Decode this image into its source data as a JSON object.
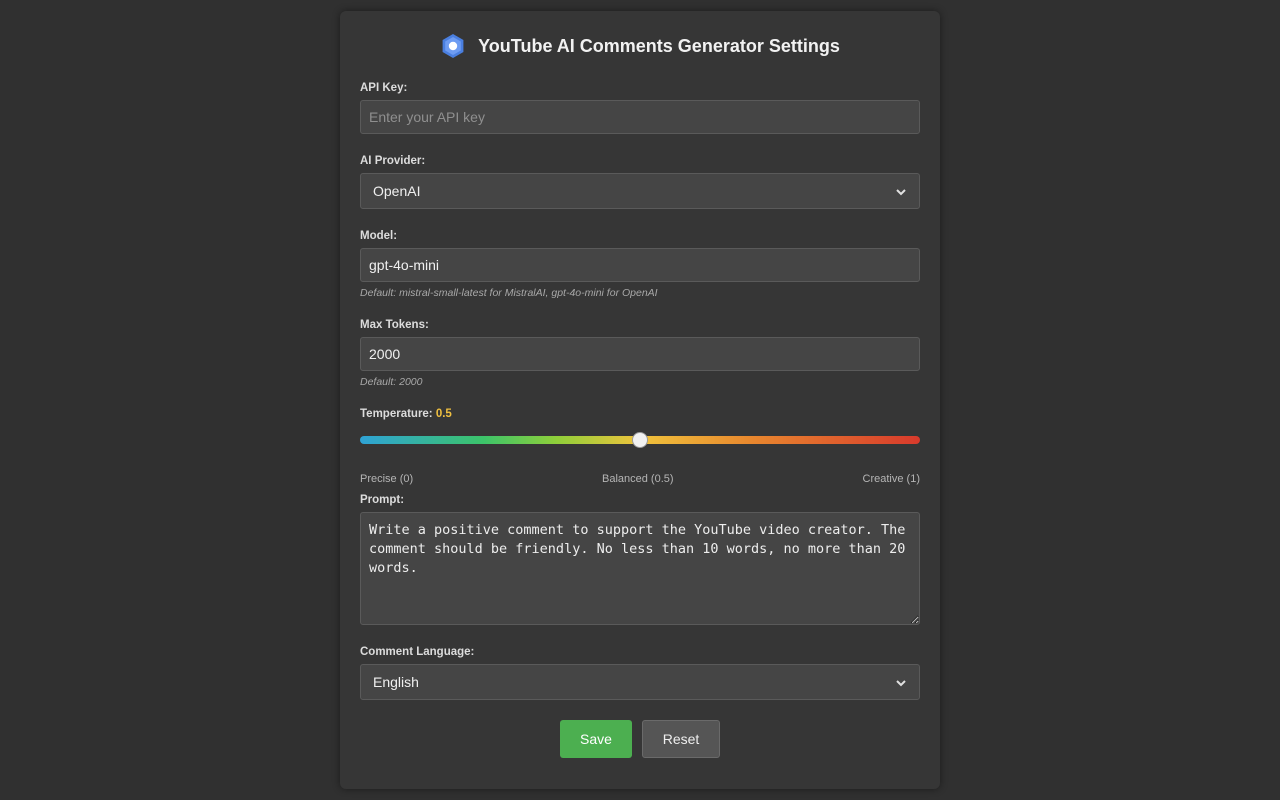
{
  "header": {
    "title": "YouTube AI Comments Generator Settings",
    "logo_icon": "hexagon-logo-icon",
    "logo_color": "#5b8def"
  },
  "fields": {
    "api_key": {
      "label": "API Key:",
      "value": "",
      "placeholder": "Enter your API key"
    },
    "provider": {
      "label": "AI Provider:",
      "selected": "OpenAI"
    },
    "model": {
      "label": "Model:",
      "value": "gpt-4o-mini",
      "hint": "Default: mistral-small-latest for MistralAI, gpt-4o-mini for OpenAI"
    },
    "max_tokens": {
      "label": "Max Tokens:",
      "value": "2000",
      "hint": "Default: 2000"
    },
    "temperature": {
      "label": "Temperature:",
      "value": "0.5",
      "level": 0.5,
      "scale_min": "Precise (0)",
      "scale_mid": "Balanced (0.5)",
      "scale_max": "Creative (1)",
      "value_color": "#f0c040"
    },
    "prompt": {
      "label": "Prompt:",
      "value": "Write a positive comment to support the YouTube video creator. The comment should be friendly. No less than 10 words, no more than 20 words."
    },
    "language": {
      "label": "Comment Language:",
      "selected": "English"
    }
  },
  "buttons": {
    "save": "Save",
    "reset": "Reset",
    "save_color": "#4caf50"
  }
}
